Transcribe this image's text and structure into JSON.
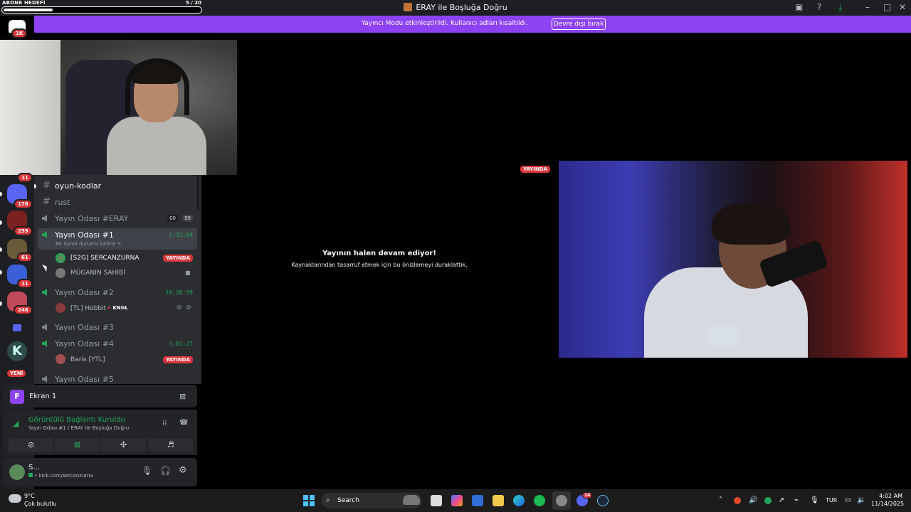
{
  "window": {
    "title": "ERAY ile Boşluğa Doğru"
  },
  "overlay": {
    "goal_label": "ABONE HEDEFİ",
    "goal_count": "5 / 20",
    "goal_progress": 0.25,
    "logo_count": "1K"
  },
  "banner": {
    "text": "Yayıncı Modu etkinleştirildi. Kullanıcı adları kısaltıldı.",
    "button": "Devre dışı bırak"
  },
  "servers": {
    "badges": [
      "11",
      "178",
      "259",
      "61",
      "11",
      "248"
    ],
    "new_label": "YENİ"
  },
  "channels": {
    "text_channels": [
      "oyun-kodlar",
      "rust"
    ],
    "room_eray": {
      "name": "Yayın Odası #ERAY",
      "counts": [
        "00",
        "99"
      ]
    },
    "room1": {
      "name": "Yayın Odası #1",
      "time": "1:31:04",
      "status_hint": "Bir kanal durumu belirle",
      "users": [
        {
          "name": "[S2G] SERCANZURNA",
          "tag": "YAYINDA"
        },
        {
          "name": "MÜGANIN SAHİBİ"
        }
      ]
    },
    "room2": {
      "name": "Yayın Odası #2",
      "time": "10:38:59",
      "user": "[TL] Hobbit",
      "user_tag": "KNGL"
    },
    "room3": {
      "name": "Yayın Odası #3"
    },
    "room4": {
      "name": "Yayın Odası #4",
      "time": "3:01:27",
      "user": "Baris [YTL]",
      "user_tag": "YAYINDA"
    },
    "room5": {
      "name": "Yayın Odası #5"
    }
  },
  "screen_share": {
    "label": "Ekran 1",
    "avatar_letter": "F"
  },
  "voice": {
    "status": "Görüntülü Bağlantı Kuruldu",
    "location": "Yayın Odası #1 / ERAY ile Boşluğa Doğru"
  },
  "user": {
    "name": "S...",
    "status": "kick.com/sercanzurna"
  },
  "stream": {
    "paused_title": "Yayının halen devam ediyor!",
    "paused_sub": "Kaynaklarından tasarruf etmek için bu önizlemeyi duraklattık.",
    "live_tag": "YAYINDA"
  },
  "taskbar": {
    "weather_temp": "9°C",
    "weather_desc": "Çok bulutlu",
    "search": "Search",
    "lang": "TUR",
    "time": "4:02 AM",
    "date": "11/14/2025",
    "discord_badge": "14"
  },
  "colors": {
    "accent": "#8d42f4",
    "live": "#da373c",
    "voice_green": "#23a559"
  }
}
